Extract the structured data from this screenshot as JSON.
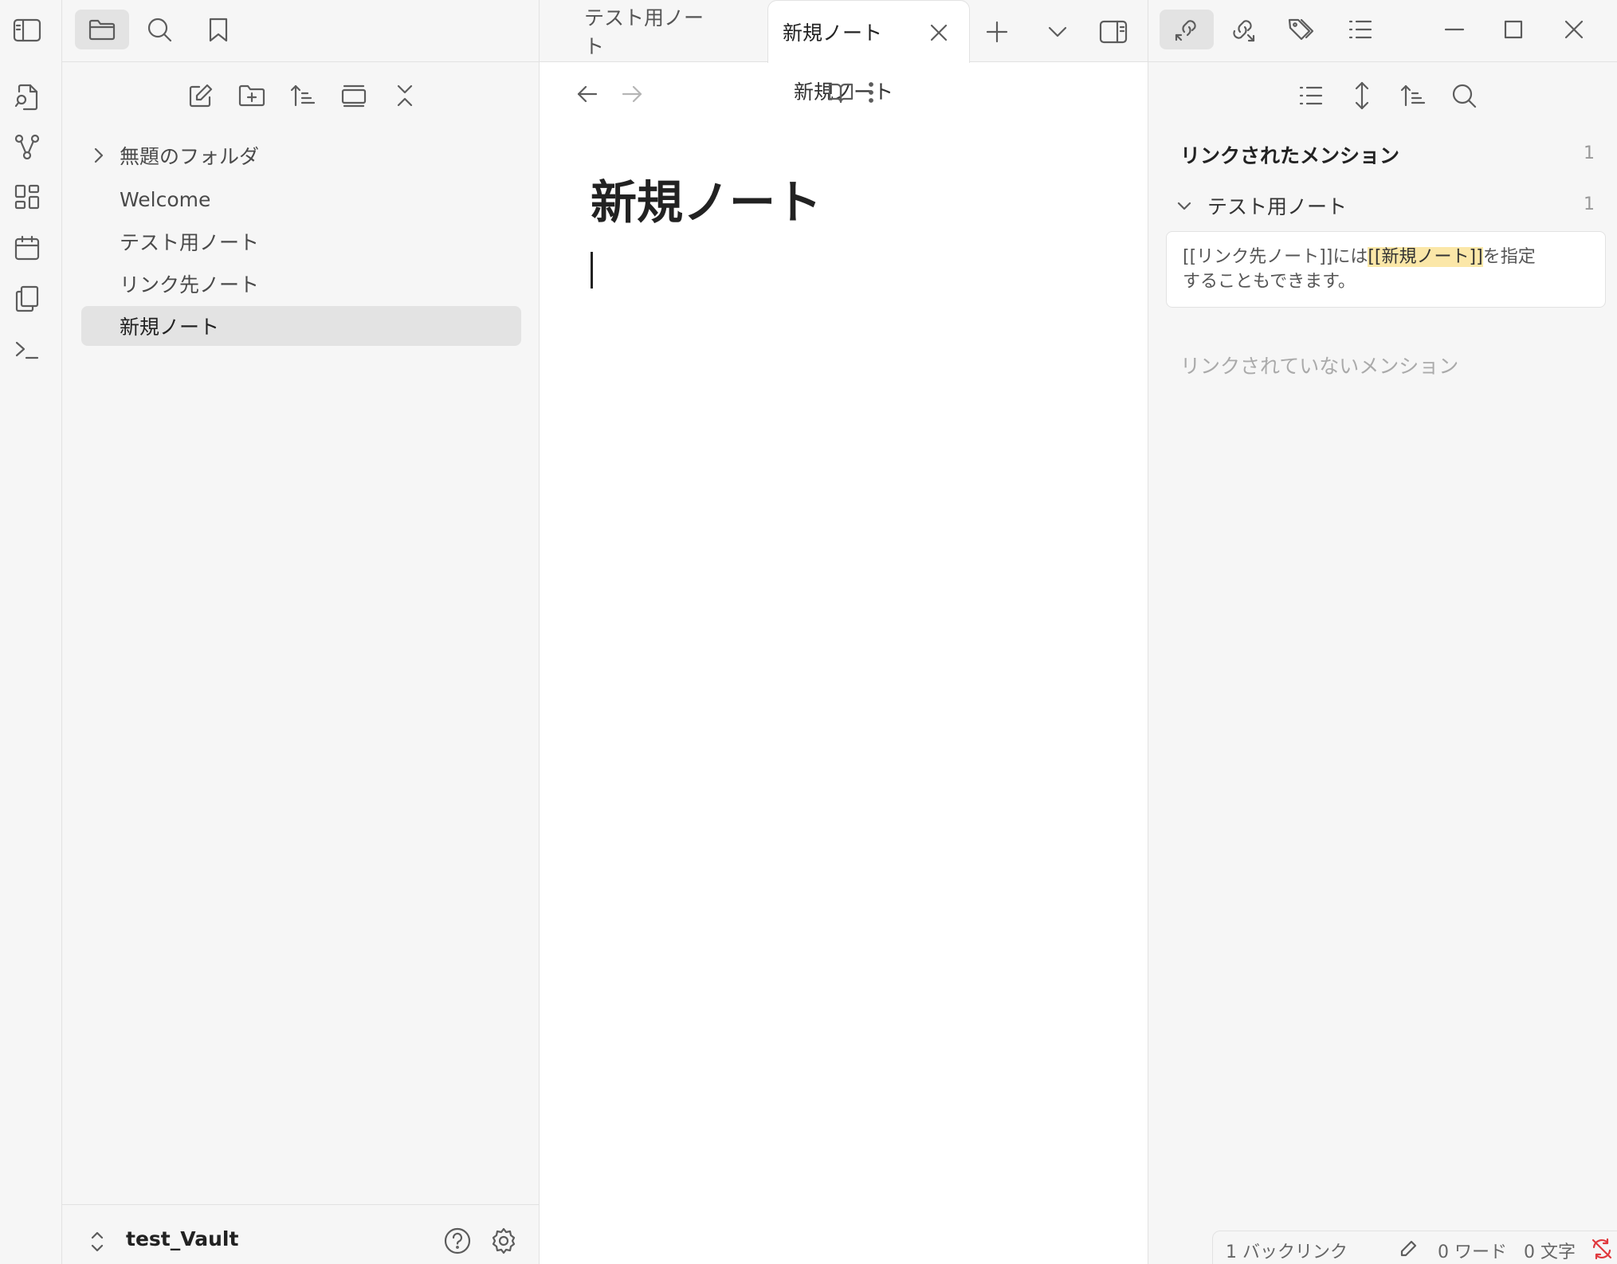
{
  "ribbon": {
    "icons": [
      "open-quick-switcher-icon",
      "graph-view-icon",
      "canvas-icon",
      "daily-note-icon",
      "templates-icon",
      "command-palette-icon"
    ]
  },
  "left_sidebar": {
    "top_tabs": [
      "sidebar-toggle-icon",
      "folder-icon",
      "search-icon",
      "bookmark-icon"
    ],
    "toolbar": [
      "new-note-icon",
      "new-folder-icon",
      "sort-icon",
      "collapse-view-icon",
      "collapse-all-icon"
    ],
    "tree": [
      {
        "label": "無題のフォルダ",
        "type": "folder"
      },
      {
        "label": "Welcome",
        "type": "file"
      },
      {
        "label": "テスト用ノート",
        "type": "file"
      },
      {
        "label": "リンク先ノート",
        "type": "file"
      },
      {
        "label": "新規ノート",
        "type": "file",
        "active": true
      }
    ],
    "vault_name": "test_Vault"
  },
  "tabs": [
    {
      "label": "テスト用ノート",
      "active": false
    },
    {
      "label": "新規ノート",
      "active": true
    }
  ],
  "editor": {
    "header_title": "新規ノート",
    "note_title": "新規ノート"
  },
  "right_sidebar": {
    "linked_mentions": {
      "title": "リンクされたメンション",
      "count": "1",
      "groups": [
        {
          "name": "テスト用ノート",
          "count": "1",
          "snippet_before": "[[リンク先ノート]]には",
          "snippet_highlight": "[[新規ノート]]",
          "snippet_after": "を指定",
          "snippet_line2": "することもできます。"
        }
      ]
    },
    "unlinked_mentions": {
      "title": "リンクされていないメンション"
    }
  },
  "status_bar": {
    "backlinks": "1 バックリンク",
    "words": "0 ワード",
    "chars": "0 文字"
  },
  "colors": {
    "highlight": "#fbe7a8",
    "sidebar_bg": "#f6f6f6",
    "active_item_bg": "#e3e3e3",
    "sync_error": "#e0393e"
  }
}
